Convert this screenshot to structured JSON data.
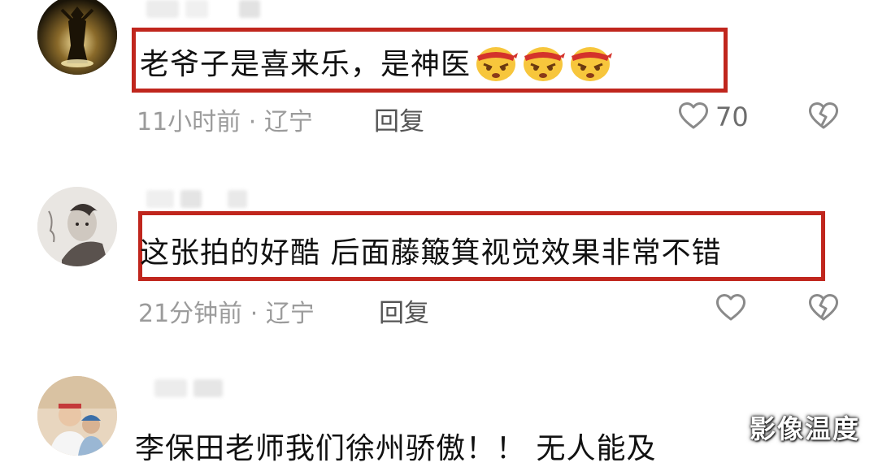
{
  "comments": [
    {
      "text": "老爷子是喜来乐，是神医",
      "emojis": [
        "angry-headband-emoji",
        "angry-headband-emoji",
        "angry-headband-emoji"
      ],
      "time": "11小时前",
      "separator": "·",
      "location": "辽宁",
      "reply_label": "回复",
      "likes": "70",
      "highlighted": true
    },
    {
      "text": "这张拍的好酷 后面藤簸箕视觉效果非常不错",
      "time": "21分钟前",
      "separator": "·",
      "location": "辽宁",
      "reply_label": "回复",
      "likes": "",
      "highlighted": true
    },
    {
      "text": "李保田老师我们徐州骄傲！！ 无人能及"
    }
  ],
  "icons": {
    "like": "heart-outline-icon",
    "dislike": "broken-heart-icon"
  },
  "colors": {
    "highlight": "#c0261d",
    "meta_text": "#9b9b9b",
    "body_text": "#111111"
  },
  "watermark": "影像温度"
}
